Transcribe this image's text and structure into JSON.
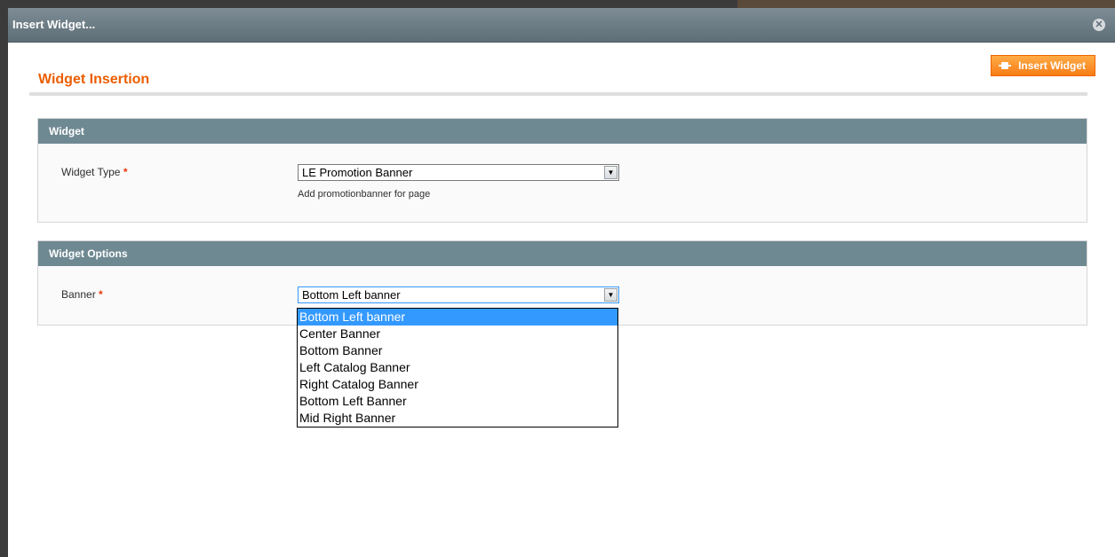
{
  "dialog": {
    "title": "Insert Widget...",
    "close_icon": "close-icon"
  },
  "header": {
    "title": "Widget Insertion",
    "insert_button_label": "Insert Widget",
    "insert_icon": "insert-widget-icon"
  },
  "widget_section": {
    "legend": "Widget",
    "type_label": "Widget Type",
    "required_mark": "*",
    "type_value": "LE Promotion Banner",
    "type_note": "Add promotionbanner for page"
  },
  "options_section": {
    "legend": "Widget Options",
    "banner_label": "Banner",
    "required_mark": "*",
    "banner_value": "Bottom Left banner",
    "banner_options": [
      "Bottom Left banner",
      "Center Banner",
      "Bottom Banner",
      "Left Catalog Banner",
      "Right Catalog Banner",
      "Bottom Left Banner",
      "Mid Right Banner"
    ]
  },
  "colors": {
    "accent": "#eb5e00",
    "button": "#f77c16",
    "section_header": "#6f8992",
    "titlebar": "#6e7e87",
    "selection": "#3399ff"
  }
}
